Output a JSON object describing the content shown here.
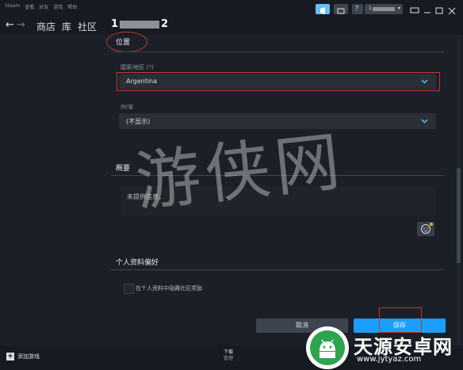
{
  "menubar": {
    "items": [
      "Steam",
      "查看",
      "好友",
      "游戏",
      "帮助"
    ],
    "account_masked": "1",
    "colors": {
      "accent": "#66c0f4",
      "bg": "#171a21"
    }
  },
  "nav": {
    "back_icon": "arrow-left-icon",
    "forward_icon": "arrow-right-icon",
    "links": [
      "商店",
      "库",
      "社区"
    ],
    "user_prefix": "1",
    "user_suffix": "2"
  },
  "location": {
    "title": "位置",
    "country_label": "国家/地区 (?)",
    "country_value": "Argentina",
    "state_label": "州/省",
    "state_value": "(不显示)"
  },
  "summary": {
    "title": "概要",
    "text": "未提供信息。",
    "emoji_icon": "smiley-icon"
  },
  "preferences": {
    "title": "个人资料偏好",
    "hide_awards_label": "在个人资料中隐藏社区奖励",
    "hide_awards_checked": false
  },
  "actions": {
    "cancel_label": "取消",
    "save_label": "保存"
  },
  "bottombar": {
    "add_game_label": "添加游戏",
    "downloads_label": "下载",
    "downloads_sub": "管理"
  },
  "watermarks": {
    "center_text": "游侠网",
    "logo_title": "天源安卓网",
    "logo_url": "www.jytyaz.com"
  }
}
